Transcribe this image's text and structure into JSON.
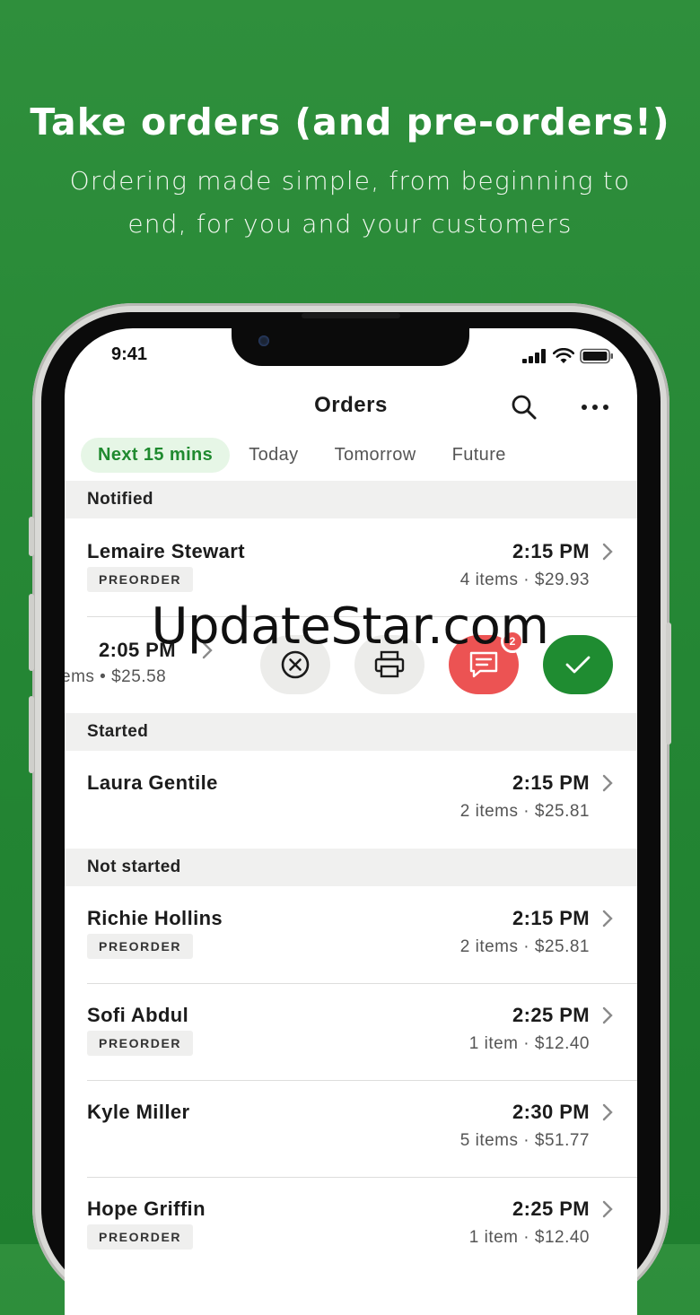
{
  "hero": {
    "title": "Take orders (and pre-orders!)",
    "subtitle": "Ordering made simple, from beginning to end, for you and your customers"
  },
  "status_bar": {
    "time": "9:41"
  },
  "nav": {
    "title": "Orders"
  },
  "tabs": [
    {
      "label": "Next 15 mins",
      "active": true
    },
    {
      "label": "Today",
      "active": false
    },
    {
      "label": "Tomorrow",
      "active": false
    },
    {
      "label": "Future",
      "active": false
    }
  ],
  "sections": {
    "notified": "Notified",
    "started": "Started",
    "not_started": "Not started"
  },
  "orders": {
    "lemaire": {
      "name": "Lemaire Stewart",
      "badge": "PREORDER",
      "time": "2:15 PM",
      "meta": "4 items · $29.93"
    },
    "swiped": {
      "time": "2:05 PM",
      "meta": "ems • $25.58",
      "message_count": "2"
    },
    "laura": {
      "name": "Laura Gentile",
      "time": "2:15 PM",
      "meta": "2 items · $25.81"
    },
    "richie": {
      "name": "Richie Hollins",
      "badge": "PREORDER",
      "time": "2:15 PM",
      "meta": "2 items · $25.81"
    },
    "sofi": {
      "name": "Sofi Abdul",
      "badge": "PREORDER",
      "time": "2:25 PM",
      "meta": "1 item · $12.40"
    },
    "kyle": {
      "name": "Kyle Miller",
      "time": "2:30 PM",
      "meta": "5 items · $51.77"
    },
    "hope": {
      "name": "Hope Griffin",
      "badge": "PREORDER",
      "time": "2:25 PM",
      "meta": "1 item · $12.40"
    }
  },
  "watermark": "UpdateStar.com",
  "colors": {
    "brand_green": "#248634",
    "tab_active_bg": "#e6f6e6",
    "message_red": "#ec5353",
    "accept_green": "#1f8c31"
  }
}
